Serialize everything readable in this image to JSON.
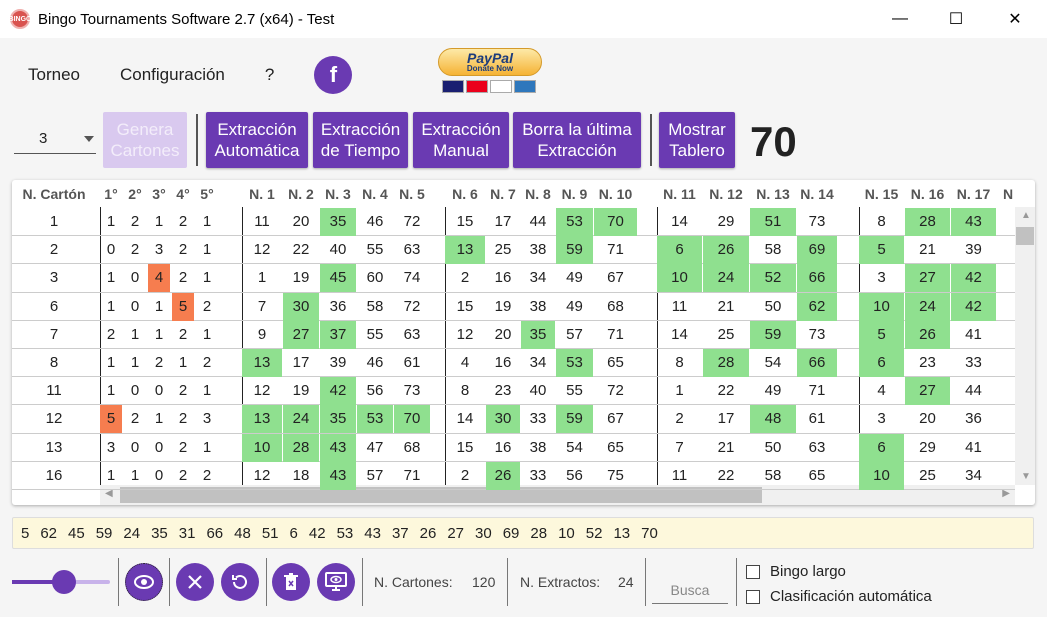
{
  "window": {
    "title": "Bingo Tournaments Software 2.7 (x64) - Test",
    "icon_label": "BINGO"
  },
  "menu": [
    "Torneo",
    "Configuración",
    "?"
  ],
  "paypal": {
    "brand": "PayPal",
    "donate": "Donate Now"
  },
  "toolbar": {
    "select_value": "3",
    "btn_genera": "Genera Cartones",
    "btn_auto": "Extracción Automática",
    "btn_tiempo": "Extracción de Tiempo",
    "btn_manual": "Extracción Manual",
    "btn_borra": "Borra la última Extracción",
    "btn_tablero": "Mostrar Tablero",
    "last_number": "70"
  },
  "grid": {
    "headers": [
      "N. Cartón",
      "1°",
      "2°",
      "3°",
      "4°",
      "5°",
      "N. 1",
      "N. 2",
      "N. 3",
      "N. 4",
      "N. 5",
      "N. 6",
      "N. 7",
      "N. 8",
      "N. 9",
      "N. 10",
      "N. 11",
      "N. 12",
      "N. 13",
      "N. 14",
      "N. 15",
      "N. 16",
      "N. 17",
      "N"
    ],
    "rows": [
      {
        "id": "1",
        "pos": [
          "1",
          "2",
          "1",
          "2",
          "1"
        ],
        "n": [
          "11",
          "20",
          "35",
          "46",
          "72",
          "15",
          "17",
          "44",
          "53",
          "70",
          "14",
          "29",
          "51",
          "73",
          "",
          "8",
          "28",
          "43"
        ]
      },
      {
        "id": "2",
        "pos": [
          "0",
          "2",
          "3",
          "2",
          "1"
        ],
        "n": [
          "12",
          "22",
          "40",
          "55",
          "63",
          "13",
          "25",
          "38",
          "59",
          "71",
          "6",
          "26",
          "58",
          "69",
          "",
          "5",
          "21",
          "39"
        ]
      },
      {
        "id": "3",
        "pos": [
          "1",
          "0",
          "4",
          "2",
          "1"
        ],
        "n": [
          "1",
          "19",
          "45",
          "60",
          "74",
          "2",
          "16",
          "34",
          "49",
          "67",
          "10",
          "24",
          "52",
          "66",
          "",
          "3",
          "27",
          "42"
        ]
      },
      {
        "id": "6",
        "pos": [
          "1",
          "0",
          "1",
          "5",
          "2"
        ],
        "n": [
          "7",
          "30",
          "36",
          "58",
          "72",
          "15",
          "19",
          "38",
          "49",
          "68",
          "11",
          "21",
          "50",
          "62",
          "",
          "10",
          "24",
          "42"
        ]
      },
      {
        "id": "7",
        "pos": [
          "2",
          "1",
          "1",
          "2",
          "1"
        ],
        "n": [
          "9",
          "27",
          "37",
          "55",
          "63",
          "12",
          "20",
          "35",
          "57",
          "71",
          "14",
          "25",
          "59",
          "73",
          "",
          "5",
          "26",
          "41"
        ]
      },
      {
        "id": "8",
        "pos": [
          "1",
          "1",
          "2",
          "1",
          "2"
        ],
        "n": [
          "13",
          "17",
          "39",
          "46",
          "61",
          "4",
          "16",
          "34",
          "53",
          "65",
          "8",
          "28",
          "54",
          "66",
          "",
          "6",
          "23",
          "33"
        ]
      },
      {
        "id": "11",
        "pos": [
          "1",
          "0",
          "0",
          "2",
          "1"
        ],
        "n": [
          "12",
          "19",
          "42",
          "56",
          "73",
          "8",
          "23",
          "40",
          "55",
          "72",
          "1",
          "22",
          "49",
          "71",
          "",
          "4",
          "27",
          "44"
        ]
      },
      {
        "id": "12",
        "pos": [
          "5",
          "2",
          "1",
          "2",
          "3"
        ],
        "n": [
          "13",
          "24",
          "35",
          "53",
          "70",
          "14",
          "30",
          "33",
          "59",
          "67",
          "2",
          "17",
          "48",
          "61",
          "",
          "3",
          "20",
          "36"
        ]
      },
      {
        "id": "13",
        "pos": [
          "3",
          "0",
          "0",
          "2",
          "1"
        ],
        "n": [
          "10",
          "28",
          "43",
          "47",
          "68",
          "15",
          "16",
          "38",
          "54",
          "65",
          "7",
          "21",
          "50",
          "63",
          "",
          "6",
          "29",
          "41"
        ]
      },
      {
        "id": "16",
        "pos": [
          "1",
          "1",
          "0",
          "2",
          "2"
        ],
        "n": [
          "12",
          "18",
          "43",
          "57",
          "71",
          "2",
          "26",
          "33",
          "56",
          "75",
          "11",
          "22",
          "58",
          "65",
          "",
          "10",
          "25",
          "34"
        ]
      }
    ]
  },
  "drawn_numbers": [
    "5",
    "62",
    "45",
    "59",
    "24",
    "35",
    "31",
    "66",
    "48",
    "51",
    "6",
    "42",
    "53",
    "43",
    "37",
    "26",
    "27",
    "30",
    "69",
    "28",
    "10",
    "52",
    "13",
    "70"
  ],
  "status": {
    "cartones_label": "N. Cartones:",
    "cartones_value": "120",
    "extractos_label": "N. Extractos:",
    "extractos_value": "24",
    "search_placeholder": "Busca",
    "chk_bingo_largo": "Bingo largo",
    "chk_clasificacion": "Clasificación automática"
  },
  "colors": {
    "accent": "#6a3ab2",
    "hit": "#8fe08f",
    "highlight": "#f67d4f"
  }
}
